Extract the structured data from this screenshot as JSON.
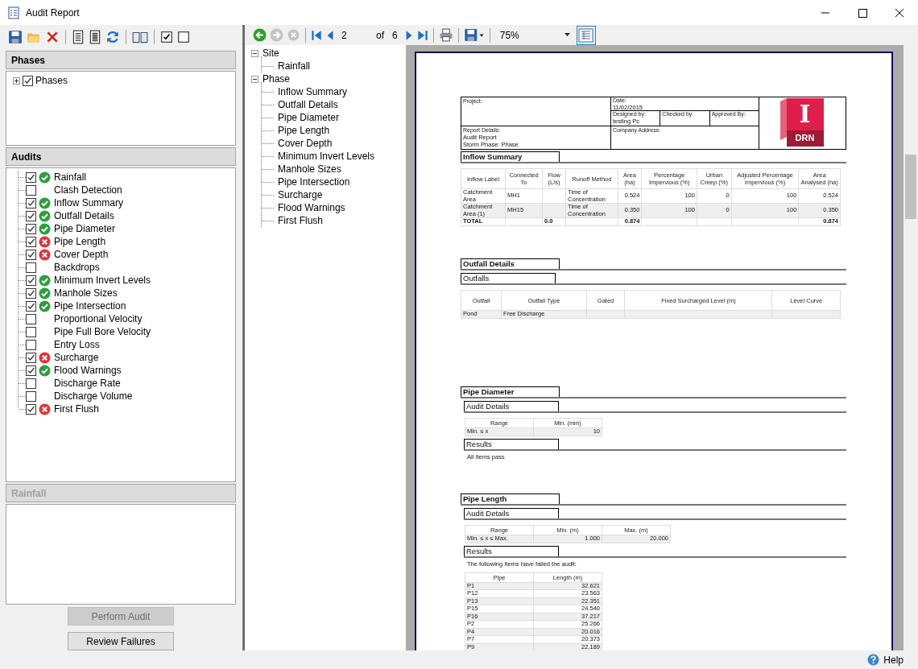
{
  "window": {
    "title": "Audit Report"
  },
  "phases": {
    "title": "Phases",
    "items": [
      {
        "label": "Phases",
        "checked": true,
        "expanded": false
      }
    ]
  },
  "audits": {
    "title": "Audits",
    "items": [
      {
        "label": "Rainfall",
        "checked": true,
        "kind": "pass"
      },
      {
        "label": "Clash Detection",
        "checked": false,
        "kind": "none"
      },
      {
        "label": "Inflow Summary",
        "checked": true,
        "kind": "pass"
      },
      {
        "label": "Outfall Details",
        "checked": true,
        "kind": "pass"
      },
      {
        "label": "Pipe Diameter",
        "checked": true,
        "kind": "pass"
      },
      {
        "label": "Pipe Length",
        "checked": true,
        "kind": "fail"
      },
      {
        "label": "Cover Depth",
        "checked": true,
        "kind": "fail"
      },
      {
        "label": "Backdrops",
        "checked": false,
        "kind": "none"
      },
      {
        "label": "Minimum Invert Levels",
        "checked": true,
        "kind": "pass"
      },
      {
        "label": "Manhole Sizes",
        "checked": true,
        "kind": "pass"
      },
      {
        "label": "Pipe Intersection",
        "checked": true,
        "kind": "pass"
      },
      {
        "label": "Proportional Velocity",
        "checked": false,
        "kind": "none"
      },
      {
        "label": "Pipe Full Bore Velocity",
        "checked": false,
        "kind": "none"
      },
      {
        "label": "Entry Loss",
        "checked": false,
        "kind": "none"
      },
      {
        "label": "Surcharge",
        "checked": true,
        "kind": "fail"
      },
      {
        "label": "Flood Warnings",
        "checked": true,
        "kind": "pass"
      },
      {
        "label": "Discharge Rate",
        "checked": false,
        "kind": "none"
      },
      {
        "label": "Discharge Volume",
        "checked": false,
        "kind": "none"
      },
      {
        "label": "First Flush",
        "checked": true,
        "kind": "fail"
      }
    ]
  },
  "details": {
    "title": "Rainfall",
    "disabled": true
  },
  "buttons": [
    {
      "label": "Perform Audit",
      "disabled": true
    },
    {
      "label": "Review Failures",
      "disabled": false
    }
  ],
  "viewer": {
    "page": "2",
    "of": "of",
    "total": "6",
    "zoom": "75%",
    "layout_selected": true
  },
  "outline": [
    {
      "label": "Site",
      "expanded": true,
      "children": [
        {
          "label": "Rainfall"
        }
      ]
    },
    {
      "label": "Phase",
      "expanded": true,
      "children": [
        {
          "label": "Inflow Summary"
        },
        {
          "label": "Outfall Details"
        },
        {
          "label": "Pipe Diameter"
        },
        {
          "label": "Pipe Length"
        },
        {
          "label": "Cover Depth"
        },
        {
          "label": "Minimum Invert Levels"
        },
        {
          "label": "Manhole Sizes"
        },
        {
          "label": "Pipe Intersection"
        },
        {
          "label": "Surcharge"
        },
        {
          "label": "Flood Warnings"
        },
        {
          "label": "First Flush"
        }
      ]
    }
  ],
  "report": {
    "header": {
      "project_label": "Project:",
      "date_label": "Date:",
      "date": "11/02/2015",
      "designed_label": "Designed by:",
      "designed": "testing Pc",
      "checked_label": "Checked by:",
      "approved_label": "Approved By:",
      "details_label": "Report Details:",
      "details": [
        "Audit Report",
        "Storm Phase: Phase"
      ],
      "company_label": "Company Address:",
      "logo_letter": "I",
      "logo_text": "DRN"
    },
    "sections": [
      {
        "title": "Inflow Summary",
        "blocks": [
          {
            "kind": "table",
            "columns": [
              {
                "label": "Inflow Label",
                "numeric": false
              },
              {
                "label": "Connected To",
                "numeric": false
              },
              {
                "label": "Flow (L/s)",
                "numeric": false
              },
              {
                "label": "Runoff Method",
                "numeric": false
              },
              {
                "label": "Area (ha)",
                "numeric": true
              },
              {
                "label": "Percentage Impervious (%)",
                "numeric": true
              },
              {
                "label": "Urban Creep (%)",
                "numeric": true
              },
              {
                "label": "Adjusted Percentage Impervious (%)",
                "numeric": true
              },
              {
                "label": "Area Analysed (ha)",
                "numeric": true
              }
            ],
            "rows": [
              {
                "cells": [
                  "Catchment Area",
                  "MH1",
                  null,
                  "Time of Concentration",
                  "0.524",
                  "100",
                  "0",
                  "100",
                  "0.524"
                ],
                "shaded": false,
                "total": false
              },
              {
                "cells": [
                  "Catchment Area (1)",
                  "MH15",
                  null,
                  "Time of Concentration",
                  "0.350",
                  "100",
                  "0",
                  "100",
                  "0.350"
                ],
                "shaded": true,
                "total": false
              },
              {
                "cells": [
                  "TOTAL",
                  null,
                  "0.0",
                  null,
                  "0.874",
                  null,
                  null,
                  null,
                  "0.874"
                ],
                "shaded": false,
                "total": true
              }
            ]
          }
        ]
      },
      {
        "title": "Outfall Details",
        "blocks": [
          {
            "kind": "subheading",
            "text": "Outfalls"
          },
          {
            "kind": "table",
            "columns": [
              {
                "label": "Outfall",
                "numeric": false
              },
              {
                "label": "Outfall Type",
                "numeric": false
              },
              {
                "label": "Gated"
              },
              {
                "label": "Fixed Surcharged Level (m)"
              },
              {
                "label": "Level Curve"
              }
            ],
            "rows": [
              {
                "cells": [
                  "Pond",
                  "Free Discharge",
                  null,
                  null,
                  null
                ],
                "shaded": true,
                "total": false
              }
            ]
          }
        ]
      },
      {
        "title": "Pipe Diameter",
        "blocks": [
          {
            "kind": "subheading",
            "text": "Audit Details"
          },
          {
            "kind": "table",
            "columns": [
              {
                "label": "Range",
                "numeric": false
              },
              {
                "label": "Min. (mm)",
                "numeric": true
              }
            ],
            "rows": [
              {
                "cells": [
                  "Min. ≤ x",
                  "10"
                ],
                "shaded": true,
                "total": false
              }
            ]
          },
          {
            "kind": "subheading",
            "text": "Results"
          },
          {
            "kind": "note",
            "text": "All Items pass"
          }
        ]
      },
      {
        "title": "Pipe Length",
        "blocks": [
          {
            "kind": "subheading",
            "text": "Audit Details"
          },
          {
            "kind": "table",
            "columns": [
              {
                "label": "Range",
                "numeric": false
              },
              {
                "label": "Min. (m)",
                "numeric": true
              },
              {
                "label": "Max. (m)",
                "numeric": true
              }
            ],
            "rows": [
              {
                "cells": [
                  "Min. ≤ x ≤ Max.",
                  "1.000",
                  "20.000"
                ],
                "shaded": true,
                "total": false
              }
            ]
          },
          {
            "kind": "subheading",
            "text": "Results"
          },
          {
            "kind": "note",
            "text": "The following Items have failed the audit:"
          },
          {
            "kind": "table",
            "columns": [
              {
                "label": "Pipe",
                "numeric": false
              },
              {
                "label": "Length (m)",
                "numeric": true
              }
            ],
            "rows": [
              {
                "cells": [
                  "P1",
                  "32.621"
                ],
                "shaded": true,
                "total": false
              },
              {
                "cells": [
                  "P12",
                  "23.563"
                ],
                "shaded": false,
                "total": false
              },
              {
                "cells": [
                  "P13",
                  "22.351"
                ],
                "shaded": true,
                "total": false
              },
              {
                "cells": [
                  "P15",
                  "24.540"
                ],
                "shaded": false,
                "total": false
              },
              {
                "cells": [
                  "P16",
                  "37.217"
                ],
                "shaded": true,
                "total": false
              },
              {
                "cells": [
                  "P2",
                  "25.266"
                ],
                "shaded": false,
                "total": false
              },
              {
                "cells": [
                  "P4",
                  "20.016"
                ],
                "shaded": true,
                "total": false
              },
              {
                "cells": [
                  "P7",
                  "20.373"
                ],
                "shaded": false,
                "total": false
              },
              {
                "cells": [
                  "P9",
                  "22.189"
                ],
                "shaded": true,
                "total": false
              }
            ]
          }
        ]
      }
    ]
  },
  "status_bar": {
    "help": "Help"
  }
}
